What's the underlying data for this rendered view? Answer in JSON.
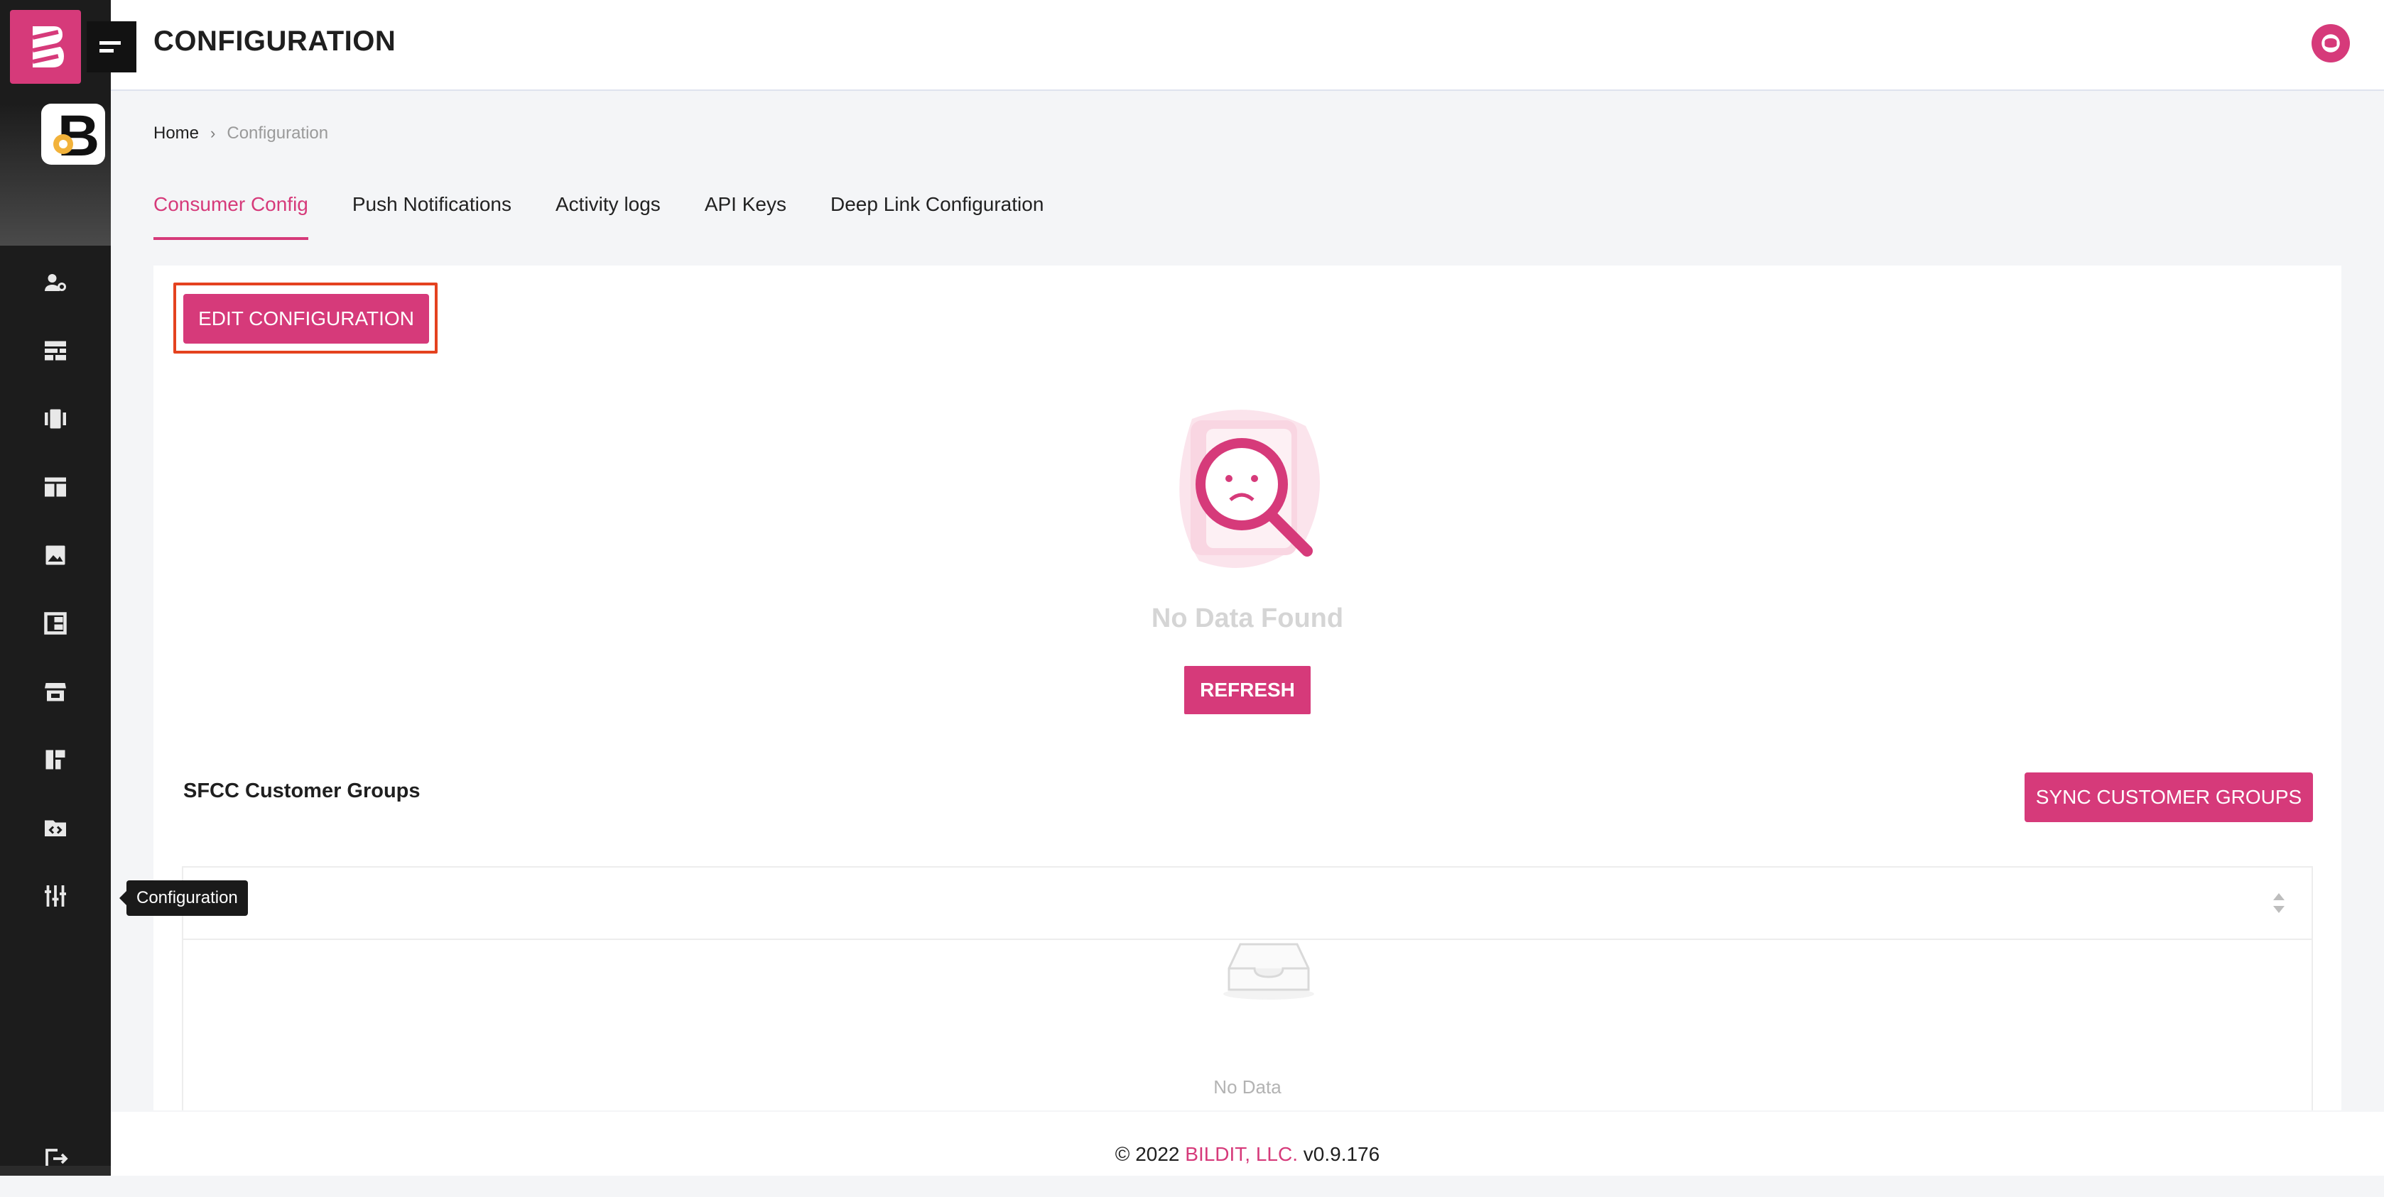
{
  "header": {
    "title": "CONFIGURATION"
  },
  "breadcrumb": {
    "home": "Home",
    "separator": "›",
    "current": "Configuration"
  },
  "tabs": [
    {
      "label": "Consumer Config",
      "active": true
    },
    {
      "label": "Push Notifications",
      "active": false
    },
    {
      "label": "Activity logs",
      "active": false
    },
    {
      "label": "API Keys",
      "active": false
    },
    {
      "label": "Deep Link Configuration",
      "active": false
    }
  ],
  "sidebar": {
    "items": [
      {
        "icon": "user-settings-icon"
      },
      {
        "icon": "dashboard-icon"
      },
      {
        "icon": "carousel-icon"
      },
      {
        "icon": "layout-icon"
      },
      {
        "icon": "image-icon"
      },
      {
        "icon": "templates-icon"
      },
      {
        "icon": "store-icon"
      },
      {
        "icon": "pages-icon"
      },
      {
        "icon": "code-folder-icon"
      },
      {
        "icon": "sliders-icon"
      }
    ],
    "tooltip": "Configuration",
    "logout_icon": "logout-icon"
  },
  "main": {
    "edit_button": "EDIT CONFIGURATION",
    "no_data_title": "No Data Found",
    "refresh_button": "REFRESH",
    "section_title": "SFCC Customer Groups",
    "sync_button": "SYNC CUSTOMER GROUPS",
    "table_empty": "No Data"
  },
  "footer": {
    "copyright": "© 2022 ",
    "brand": "BILDIT, LLC.",
    "version": " v0.9.176"
  },
  "colors": {
    "accent": "#d63a7a",
    "sidebar": "#1c1c1c",
    "highlight": "#e4421f"
  }
}
